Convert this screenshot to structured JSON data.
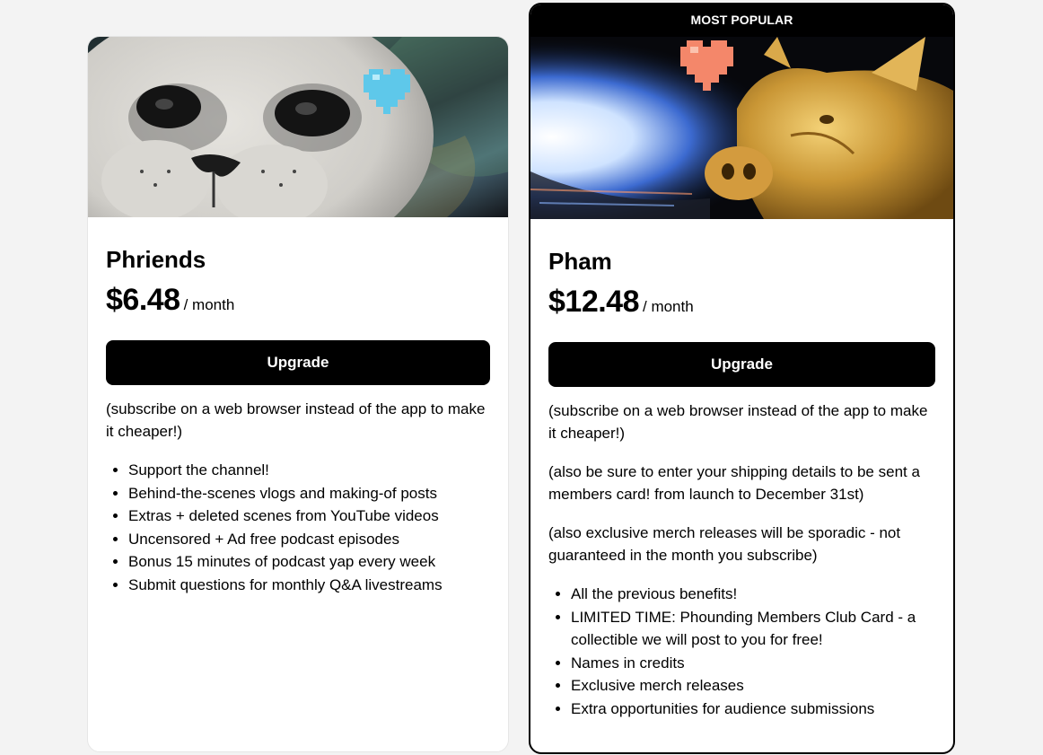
{
  "tiers": [
    {
      "name": "Phriends",
      "price": "$6.48",
      "period": "/ month",
      "button_label": "Upgrade",
      "notes": [
        "(subscribe on a web browser instead of the app to make it cheaper!)"
      ],
      "benefits": [
        "Support the channel!",
        "Behind-the-scenes vlogs and making-of posts",
        "Extras + deleted scenes from YouTube videos",
        "Uncensored + Ad free podcast episodes",
        "Bonus 15 minutes of podcast yap every week",
        "Submit questions for monthly Q&A livestreams"
      ],
      "heart_color": "#5ec8ea"
    },
    {
      "badge": "MOST POPULAR",
      "name": "Pham",
      "price": "$12.48",
      "period": "/ month",
      "button_label": "Upgrade",
      "notes": [
        "(subscribe on a web browser instead of the app to make it cheaper!)",
        "(also be sure to enter your shipping details to be sent a members card! from launch to December 31st)",
        "(also exclusive merch releases will be sporadic - not guaranteed in the month you subscribe)"
      ],
      "benefits": [
        "All the previous benefits!",
        "LIMITED TIME: Phounding Members Club Card - a collectible we will post to you for free!",
        "Names in credits",
        "Exclusive merch releases",
        "Extra opportunities for audience submissions"
      ],
      "heart_color": "#f4876a"
    }
  ]
}
